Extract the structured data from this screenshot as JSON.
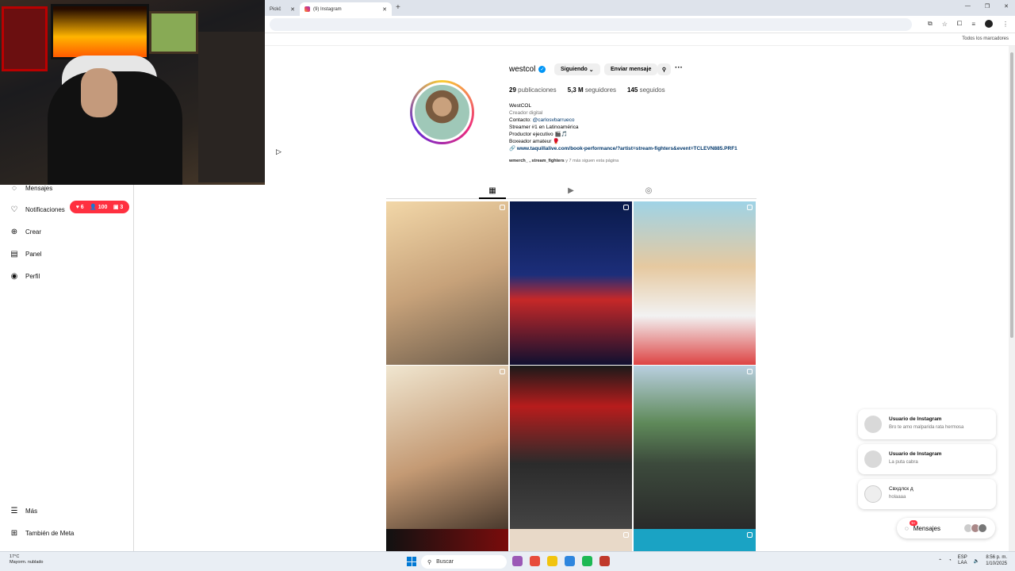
{
  "browser": {
    "tabs": [
      {
        "label": "Pickc̈"
      },
      {
        "label": "(9) Instagram"
      }
    ],
    "bookmarks_all": "Todos los marcadores"
  },
  "sidebar": {
    "items": [
      {
        "label": "Mensajes",
        "icon": "messenger-icon"
      },
      {
        "label": "Notificaciones",
        "icon": "heart-icon"
      },
      {
        "label": "Crear",
        "icon": "plus-icon"
      },
      {
        "label": "Panel",
        "icon": "dashboard-icon"
      },
      {
        "label": "Perfil",
        "icon": "avatar-icon"
      },
      {
        "label": "Más",
        "icon": "menu-icon"
      },
      {
        "label": "También de Meta",
        "icon": "meta-icon"
      }
    ],
    "notif_badge": {
      "likes": "6",
      "follows": "100",
      "comments": "3"
    }
  },
  "profile": {
    "username": "westcol",
    "follow_button": "Siguiendo",
    "message_button": "Enviar mensaje",
    "stats": {
      "posts_count": "29",
      "posts_label": "publicaciones",
      "followers_count": "5,3 M",
      "followers_label": "seguidores",
      "following_count": "145",
      "following_label": "seguidos"
    },
    "bio": {
      "name": "WestCOL",
      "category": "Creador digital",
      "contact_prefix": "Contacto:",
      "contact_handle": "@carlosvbarrueco",
      "line2": "Streamer #1 en Latinoamérica",
      "line3": "Productor ejecutivo 🎬🎵",
      "line4": "Boxeador amateur 🥊",
      "link": "www.taquillalive.com/book-performance/?artist=stream-fighters&event=TCLEVN885.PRF1"
    },
    "followed_by_names": "wmerch_ , stream_fighters",
    "followed_by_rest": "y 7 más siguen esta página"
  },
  "chats": [
    {
      "name": "Usuario de Instagram",
      "message": "Bro te amo malparida rata hermosa"
    },
    {
      "name": "Usuario de Instagram",
      "message": "La puta cabra"
    },
    {
      "name": "Cвхдлск д",
      "message": "holaaaa"
    }
  ],
  "messages_pill": {
    "label": "Mensajes",
    "badge": "9+"
  },
  "taskbar": {
    "weather_temp": "17°C",
    "weather_desc": "Mayorm. nublado",
    "search_placeholder": "Buscar",
    "lang": "ESP",
    "lang2": "LAA",
    "time": "8:56 p. m.",
    "date": "1/10/2025"
  },
  "colors": {
    "accent": "#0095f6",
    "badge": "#ff3040",
    "text_secondary": "#737373"
  }
}
